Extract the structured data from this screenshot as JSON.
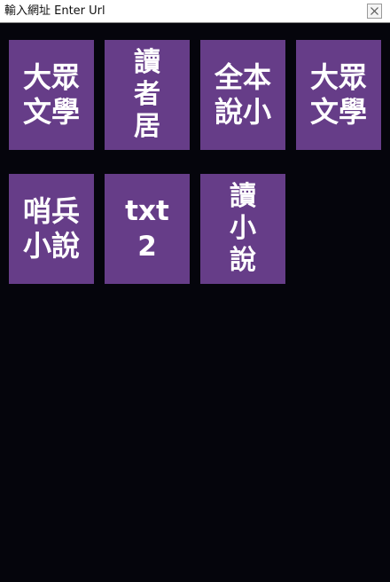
{
  "url_bar": {
    "placeholder": "輸入網址 Enter Url"
  },
  "icons": {
    "close": "close-icon"
  },
  "colors": {
    "background": "#05050c",
    "tile": "#663d88",
    "tile_text": "#ffffff"
  },
  "tiles": [
    {
      "lines": [
        "大眾",
        "文學"
      ]
    },
    {
      "lines": [
        "讀",
        "者",
        "居"
      ]
    },
    {
      "lines": [
        "全本",
        "說小"
      ]
    },
    {
      "lines": [
        "大眾",
        "文學"
      ]
    },
    {
      "lines": [
        "哨兵",
        "小說"
      ]
    },
    {
      "lines": [
        "txt",
        "2"
      ]
    },
    {
      "lines": [
        "讀",
        "小",
        "說"
      ]
    }
  ]
}
